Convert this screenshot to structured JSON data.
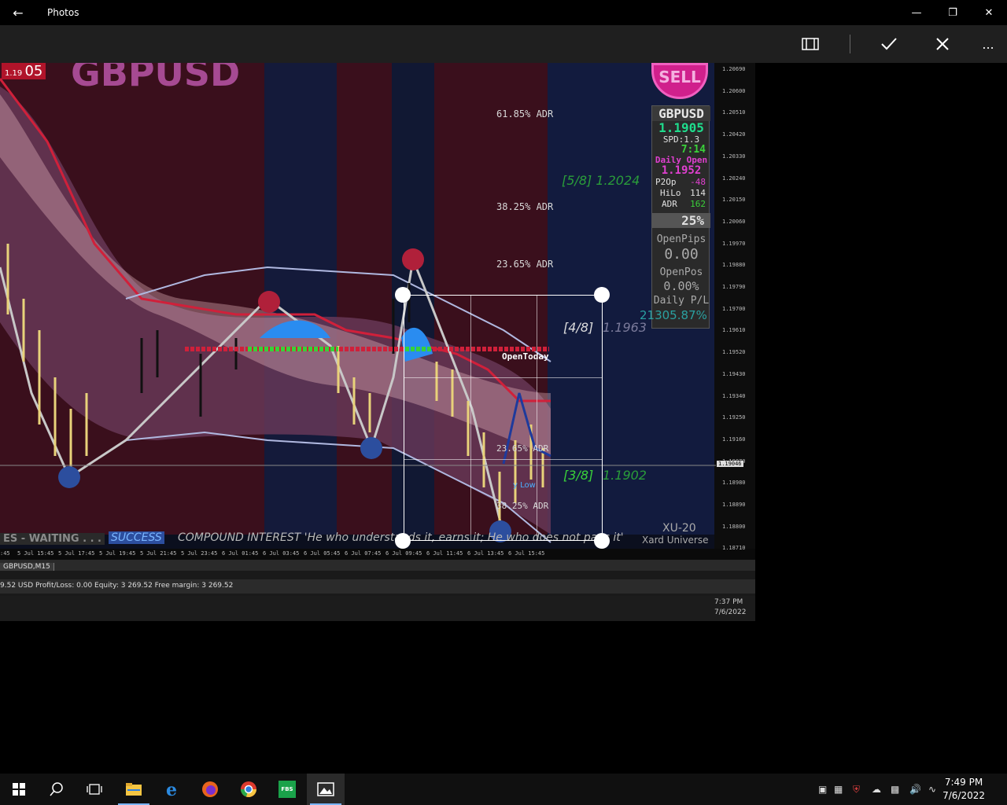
{
  "app": {
    "title": "Photos"
  },
  "toolbar": {
    "aspect_icon": "aspect-ratio-icon",
    "done_icon": "check-icon",
    "cancel_icon": "close-icon",
    "more_label": "..."
  },
  "chart": {
    "symbol": "GBPUSD",
    "price_badge": "1.19",
    "price_badge_big": "05",
    "sell_label": "SELL",
    "adr_levels": [
      "61.85% ADR",
      "38.25% ADR",
      "23.65% ADR",
      "23.65% ADR",
      "38.25% ADR"
    ],
    "murrey": [
      "[5/8] 1.2024",
      "[4/8]",
      "1.1963",
      "[3/8]",
      "1.1902"
    ],
    "open_today": "OpenToday",
    "low_label": "y Low",
    "panel": {
      "symbol": "GBPUSD",
      "price": "1.1905",
      "spd": "SPD:1.3",
      "time": "7:14",
      "daily_open_label": "Daily Open",
      "daily_open": "1.1952",
      "p2op_label": "P2Op",
      "p2op": "-48",
      "hilo_label": "HiLo",
      "hilo": "114",
      "adr_label": "ADR",
      "adr": "162",
      "pct": "25%",
      "openpips_label": "OpenPips",
      "openpips": "0.00",
      "openpos_label": "OpenPos",
      "openpos": "0.00%",
      "dailypl_label": "Daily P/L",
      "dailypl": "21305.87%"
    },
    "y_ticks": [
      "1.20690",
      "1.20600",
      "1.20510",
      "1.20420",
      "1.20330",
      "1.20240",
      "1.20150",
      "1.20060",
      "1.19970",
      "1.19880",
      "1.19790",
      "1.19700",
      "1.19610",
      "1.19520",
      "1.19430",
      "1.19340",
      "1.19250",
      "1.19160",
      "1.19070",
      "1.18980",
      "1.18890",
      "1.18800",
      "1.18710"
    ],
    "current_price_tag": "1.19046",
    "x_ticks": [
      "5 Jul 15:45",
      "5 Jul 17:45",
      "5 Jul 19:45",
      "5 Jul 21:45",
      "5 Jul 23:45",
      "6 Jul 01:45",
      "6 Jul 03:45",
      "6 Jul 05:45",
      "6 Jul 07:45",
      "6 Jul 09:45",
      "6 Jul 11:45",
      "6 Jul 13:45",
      "6 Jul 15:45"
    ],
    "x_tick_prefix": ":45",
    "ticker_waiting": "ES - WAITING . . .",
    "ticker_success": "SUCCESS",
    "ticker_quote": "COMPOUND INTEREST 'He who understands it, earns it; He who does not pays it'",
    "brand": "XU-20",
    "brand_sub": "Xard Universe",
    "tab_label": "GBPUSD,M15",
    "status_line": "9.52 USD  Profit/Loss: 0.00  Equity: 3 269.52  Free margin: 3 269.52",
    "inner_clock_time": "7:37 PM",
    "inner_clock_date": "7/6/2022"
  },
  "taskbar": {
    "time": "7:49 PM",
    "date": "7/6/2022",
    "fbs_label": "FBS"
  },
  "colors": {
    "toolbar": "#1f1f1f",
    "accent": "#7ab5ff",
    "panel_green": "#1fdc8c",
    "panel_magenta": "#e040d0"
  }
}
